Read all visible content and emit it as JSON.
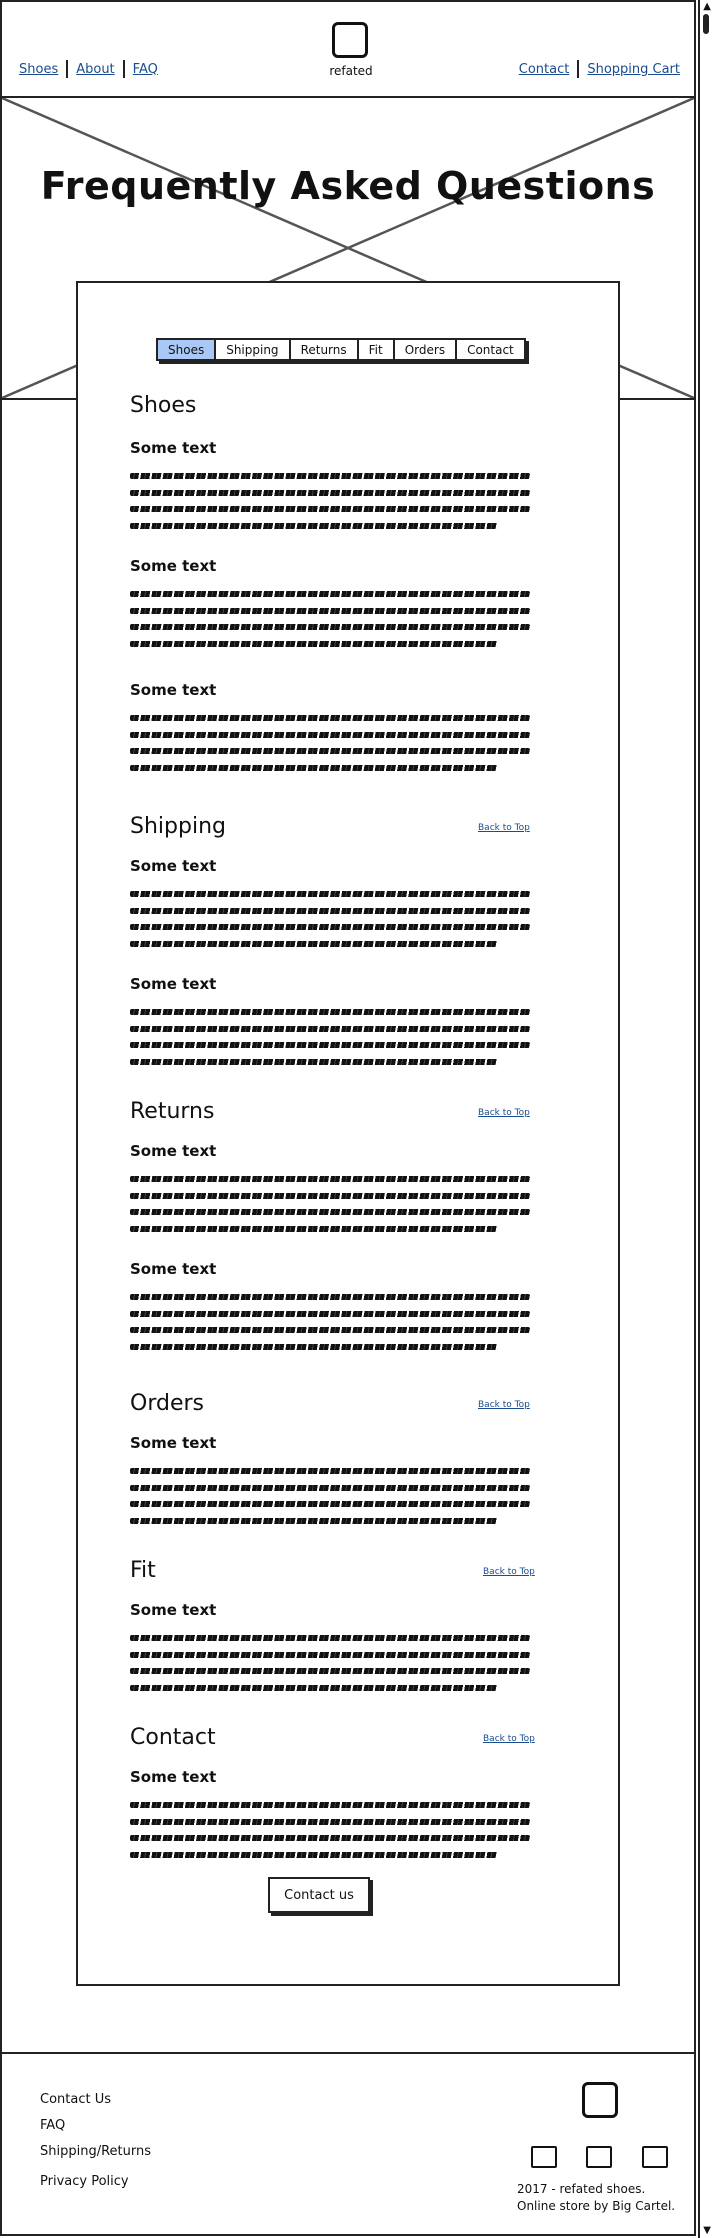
{
  "nav": {
    "left": [
      "Shoes",
      "About",
      "FAQ"
    ],
    "right": [
      "Contact",
      "Shopping Cart"
    ],
    "logo_text": "refated"
  },
  "hero": {
    "title": "Frequently Asked Questions"
  },
  "tabs": [
    "Shoes",
    "Shipping",
    "Returns",
    "Fit",
    "Orders",
    "Contact"
  ],
  "sections": [
    {
      "title": "Shoes",
      "back_to_top": "",
      "items": [
        "Some text",
        "Some text",
        "Some text"
      ]
    },
    {
      "title": "Shipping",
      "back_to_top": "Back to Top",
      "items": [
        "Some text",
        "Some text"
      ]
    },
    {
      "title": "Returns",
      "back_to_top": "Back to Top",
      "items": [
        "Some text",
        "Some text"
      ]
    },
    {
      "title": "Orders",
      "back_to_top": "Back to Top",
      "items": [
        "Some text"
      ]
    },
    {
      "title": "Fit",
      "back_to_top": "Back to Top",
      "items": [
        "Some text"
      ]
    },
    {
      "title": "Contact",
      "back_to_top": "Back to Top",
      "items": [
        "Some text"
      ]
    }
  ],
  "contact_button": "Contact us",
  "footer": {
    "links": [
      "Contact Us",
      "FAQ",
      "Shipping/Returns",
      "Privacy Policy"
    ],
    "copyright_line1": "2017 - refated shoes.",
    "copyright_line2": "Online store by Big Cartel."
  },
  "icons": {
    "logo": "logo-placeholder-icon",
    "social": [
      "social-icon-1",
      "social-icon-2",
      "social-icon-3"
    ],
    "hero_image": "image-placeholder-icon"
  },
  "colors": {
    "link": "#1a4d8f",
    "active_tab": "#a9c8f5",
    "stroke": "#222222"
  }
}
